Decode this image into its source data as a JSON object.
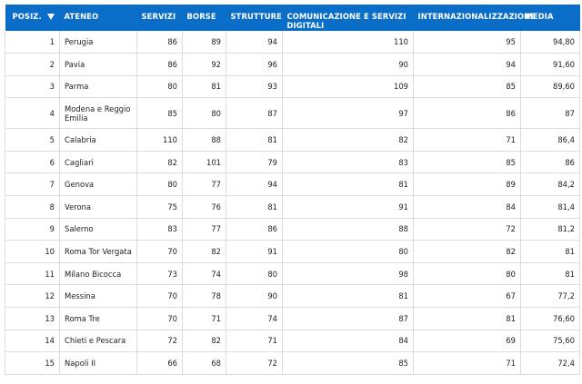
{
  "table": {
    "headers": {
      "pos": "POSIZ.",
      "ateneo": "ATENEO",
      "servizi": "SERVIZI",
      "borse": "BORSE",
      "strutture": "STRUTTURE",
      "comunicazione": "COMUNICAZIONE E SERVIZI DIGITALI",
      "internazionalizzazione": "INTERNAZIONALIZZAZIONE",
      "media": "MEDIA"
    },
    "rows": [
      {
        "pos": "1",
        "ateneo": "Perugia",
        "servizi": "86",
        "borse": "89",
        "strutture": "94",
        "comunicazione": "110",
        "internazionalizzazione": "95",
        "media": "94,80"
      },
      {
        "pos": "2",
        "ateneo": "Pavia",
        "servizi": "86",
        "borse": "92",
        "strutture": "96",
        "comunicazione": "90",
        "internazionalizzazione": "94",
        "media": "91,60"
      },
      {
        "pos": "3",
        "ateneo": "Parma",
        "servizi": "80",
        "borse": "81",
        "strutture": "93",
        "comunicazione": "109",
        "internazionalizzazione": "85",
        "media": "89,60"
      },
      {
        "pos": "4",
        "ateneo": "Modena e Reggio Emilia",
        "servizi": "85",
        "borse": "80",
        "strutture": "87",
        "comunicazione": "97",
        "internazionalizzazione": "86",
        "media": "87"
      },
      {
        "pos": "5",
        "ateneo": "Calabria",
        "servizi": "110",
        "borse": "88",
        "strutture": "81",
        "comunicazione": "82",
        "internazionalizzazione": "71",
        "media": "86,4"
      },
      {
        "pos": "6",
        "ateneo": "Cagliari",
        "servizi": "82",
        "borse": "101",
        "strutture": "79",
        "comunicazione": "83",
        "internazionalizzazione": "85",
        "media": "86"
      },
      {
        "pos": "7",
        "ateneo": "Genova",
        "servizi": "80",
        "borse": "77",
        "strutture": "94",
        "comunicazione": "81",
        "internazionalizzazione": "89",
        "media": "84,2"
      },
      {
        "pos": "8",
        "ateneo": "Verona",
        "servizi": "75",
        "borse": "76",
        "strutture": "81",
        "comunicazione": "91",
        "internazionalizzazione": "84",
        "media": "81,4"
      },
      {
        "pos": "9",
        "ateneo": "Salerno",
        "servizi": "83",
        "borse": "77",
        "strutture": "86",
        "comunicazione": "88",
        "internazionalizzazione": "72",
        "media": "81,2"
      },
      {
        "pos": "10",
        "ateneo": "Roma Tor Vergata",
        "servizi": "70",
        "borse": "82",
        "strutture": "91",
        "comunicazione": "80",
        "internazionalizzazione": "82",
        "media": "81"
      },
      {
        "pos": "11",
        "ateneo": "Milano Bicocca",
        "servizi": "73",
        "borse": "74",
        "strutture": "80",
        "comunicazione": "98",
        "internazionalizzazione": "80",
        "media": "81"
      },
      {
        "pos": "12",
        "ateneo": "Messina",
        "servizi": "70",
        "borse": "78",
        "strutture": "90",
        "comunicazione": "81",
        "internazionalizzazione": "67",
        "media": "77,2"
      },
      {
        "pos": "13",
        "ateneo": "Roma Tre",
        "servizi": "70",
        "borse": "71",
        "strutture": "74",
        "comunicazione": "87",
        "internazionalizzazione": "81",
        "media": "76,60"
      },
      {
        "pos": "14",
        "ateneo": "Chieti e Pescara",
        "servizi": "72",
        "borse": "82",
        "strutture": "71",
        "comunicazione": "84",
        "internazionalizzazione": "69",
        "media": "75,60"
      },
      {
        "pos": "15",
        "ateneo": "Napoli II",
        "servizi": "66",
        "borse": "68",
        "strutture": "72",
        "comunicazione": "85",
        "internazionalizzazione": "71",
        "media": "72,4"
      }
    ],
    "sort_icon": "caret-down-icon",
    "header_color": "#0a6ec9"
  }
}
